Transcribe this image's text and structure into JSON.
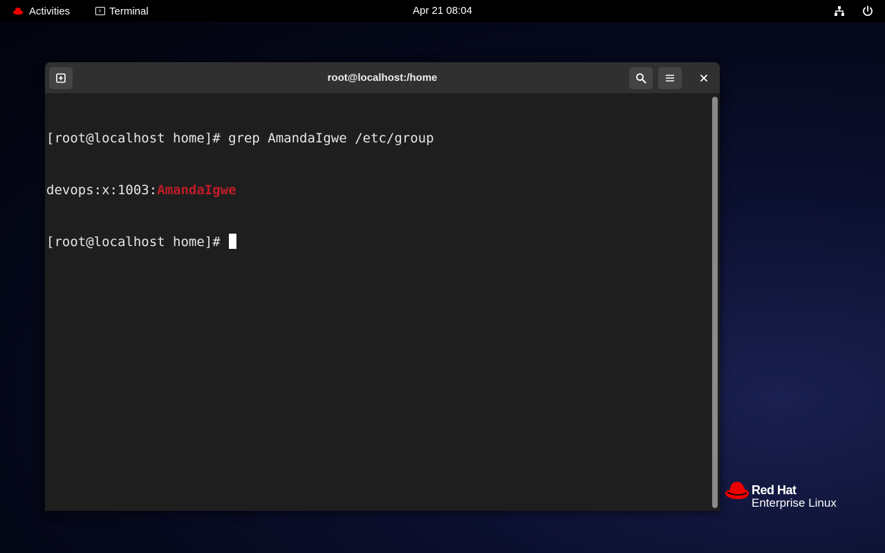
{
  "topbar": {
    "activities_label": "Activities",
    "app_name": "Terminal",
    "clock": "Apr 21  08:04"
  },
  "window": {
    "title": "root@localhost:/home"
  },
  "terminal": {
    "line1": "[root@localhost home]# grep AmandaIgwe /etc/group",
    "line2_prefix": "devops:x:1003:",
    "line2_match": "AmandaIgwe",
    "line3_prompt": "[root@localhost home]# "
  },
  "brand": {
    "line1": "Red Hat",
    "line2": "Enterprise Linux"
  },
  "colors": {
    "grep_match": "#c01c28",
    "redhat_red": "#ee0000",
    "terminal_bg": "#1e1e1e",
    "headerbar_bg": "#303030"
  },
  "icons": [
    "redhat-hat-icon",
    "terminal-icon",
    "network-icon",
    "power-icon",
    "new-tab-icon",
    "search-icon",
    "hamburger-menu-icon",
    "close-icon"
  ]
}
